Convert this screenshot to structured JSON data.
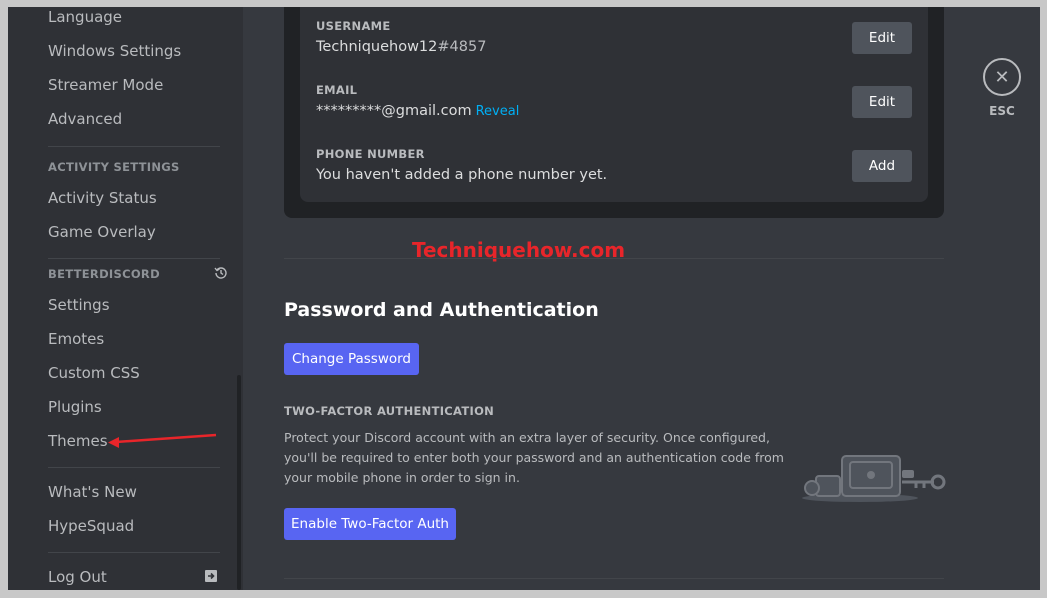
{
  "sidebar": {
    "items_top": [
      {
        "label": "Language"
      },
      {
        "label": "Windows Settings"
      },
      {
        "label": "Streamer Mode"
      },
      {
        "label": "Advanced"
      }
    ],
    "activity_header": "ACTIVITY SETTINGS",
    "activity_items": [
      {
        "label": "Activity Status"
      },
      {
        "label": "Game Overlay"
      }
    ],
    "betterdiscord_header": "BETTERDISCORD",
    "betterdiscord_items": [
      {
        "label": "Settings"
      },
      {
        "label": "Emotes"
      },
      {
        "label": "Custom CSS"
      },
      {
        "label": "Plugins"
      },
      {
        "label": "Themes"
      }
    ],
    "misc_items": [
      {
        "label": "What's New"
      },
      {
        "label": "HypeSquad"
      }
    ],
    "logout_label": "Log Out"
  },
  "account": {
    "username_label": "USERNAME",
    "username": "Techniquehow12",
    "discriminator": "#4857",
    "email_label": "EMAIL",
    "email": "*********@gmail.com",
    "reveal_label": "Reveal",
    "phone_label": "PHONE NUMBER",
    "phone_value": "You haven't added a phone number yet.",
    "edit_label": "Edit",
    "add_label": "Add"
  },
  "watermark": "Techniquehow.com",
  "password_section": {
    "title": "Password and Authentication",
    "change_password_label": "Change Password",
    "tfa_header": "TWO-FACTOR AUTHENTICATION",
    "tfa_description": "Protect your Discord account with an extra layer of security. Once configured, you'll be required to enter both your password and an authentication code from your mobile phone in order to sign in.",
    "enable_tfa_label": "Enable Two-Factor Auth"
  },
  "close": {
    "esc_label": "ESC"
  },
  "colors": {
    "brand": "#5865f2",
    "background": "#36393f",
    "sidebar": "#2f3136",
    "link": "#00aff4",
    "annotation": "#e8252a"
  },
  "icons": [
    "history-icon",
    "logout-icon",
    "close-icon",
    "security-illustration-icon",
    "annotation-arrow-icon"
  ]
}
